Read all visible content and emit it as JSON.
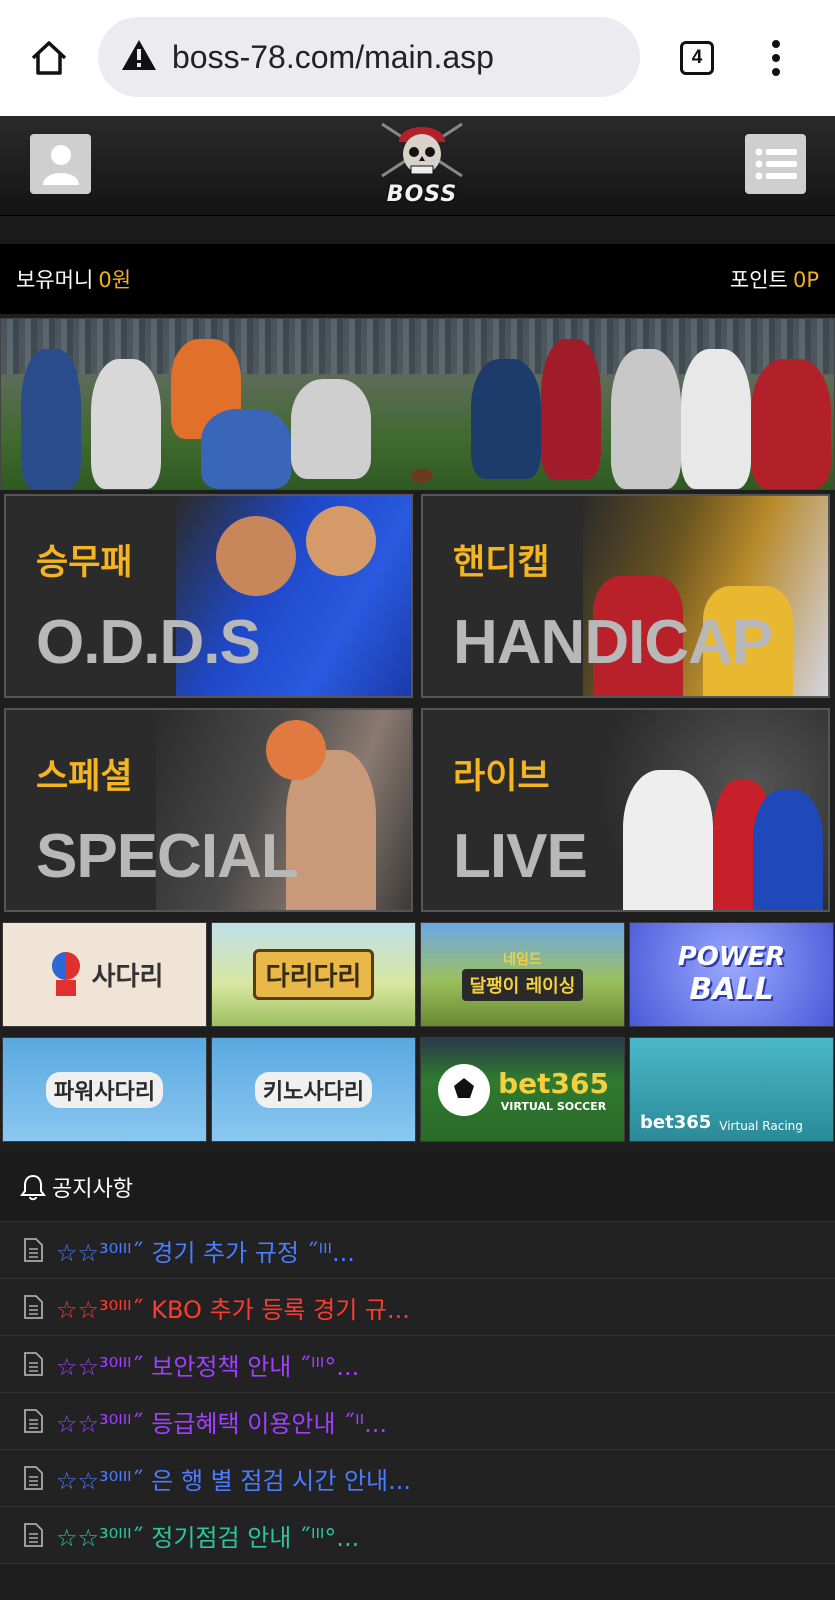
{
  "browser": {
    "url": "boss-78.com/main.asp",
    "tab_count": "4",
    "icons": [
      "home-icon",
      "warning-icon",
      "tabs-icon",
      "more-vert-icon"
    ]
  },
  "header": {
    "logo_text": "BOSS",
    "icons": [
      "user-icon",
      "list-menu-icon",
      "pirate-skull-logo"
    ]
  },
  "balance": {
    "money_label": "보유머니",
    "money_value": "0원",
    "point_label": "포인트",
    "point_value": "0P"
  },
  "categories": [
    {
      "kr": "승무패",
      "en": "O.D.D.S"
    },
    {
      "kr": "핸디캡",
      "en": "HANDICAP"
    },
    {
      "kr": "스페셜",
      "en": "SPECIAL"
    },
    {
      "kr": "라이브",
      "en": "LIVE"
    }
  ],
  "games": [
    {
      "label": "사다리"
    },
    {
      "label": "다리다리"
    },
    {
      "label": "네임드",
      "sub": "달팽이 레이싱"
    },
    {
      "label": "POWER",
      "sub": "BALL"
    },
    {
      "label": "파워사다리"
    },
    {
      "label": "키노사다리"
    },
    {
      "label": "bet365",
      "sub": "VIRTUAL SOCCER"
    },
    {
      "label": "bet365",
      "sub": "Virtual Racing"
    }
  ],
  "notices": {
    "title": "공지사항",
    "items": [
      {
        "text": "☆☆³⁰ᴵᴵᴵ˝ 경기 추가 규정 ˝ᴵᴵᴵ...",
        "color": "#4a7cff"
      },
      {
        "text": "☆☆³⁰ᴵᴵᴵ˝ KBO 추가 등록 경기 규...",
        "color": "#ff3b2f"
      },
      {
        "text": "☆☆³⁰ᴵᴵᴵ˝ 보안정책 안내 ˝ᴵᴵᴵ°...",
        "color": "#a040ff"
      },
      {
        "text": "☆☆³⁰ᴵᴵᴵ˝ 등급혜택 이용안내 ˝ᴵᴵ...",
        "color": "#a040ff"
      },
      {
        "text": "☆☆³⁰ᴵᴵᴵ˝ 은 행 별 점검 시간 안내...",
        "color": "#4a7cff"
      },
      {
        "text": "☆☆³⁰ᴵᴵᴵ˝ 정기점검 안내 ˝ᴵᴵᴵ°...",
        "color": "#2ec4a0"
      }
    ]
  },
  "colors": {
    "accent_gold": "#f0b020",
    "background": "#1e1e1e"
  }
}
